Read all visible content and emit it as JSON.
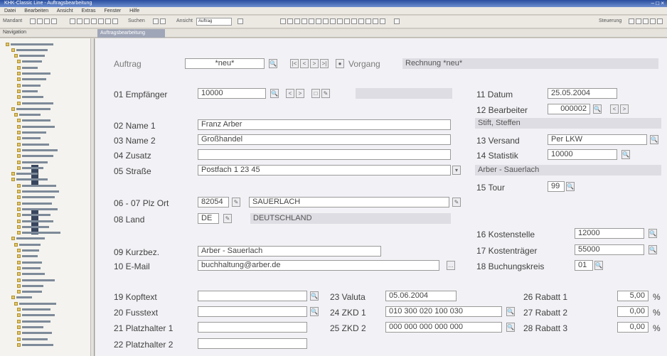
{
  "window": {
    "title": "KHK-Classic Line - Auftragsbearbeitung"
  },
  "menu": [
    "Datei",
    "Bearbeiten",
    "Ansicht",
    "Extras",
    "Fenster",
    "Hilfe"
  ],
  "toolbar": {
    "left_label": "Mandant",
    "search_placeholder": "Suchen",
    "field_label": "Ansicht",
    "combo_value": "Auftrag",
    "right_label": "Steuerung"
  },
  "tab": {
    "sidebar_title": "Navigation",
    "active": "Auftragsbearbeitung"
  },
  "header": {
    "auftrag_label": "Auftrag",
    "auftrag_value": "*neu*",
    "vorgang_label": "Vorgang",
    "vorgang_value": "Rechnung *neu*"
  },
  "fields": {
    "empfaenger": {
      "label": "01 Empfänger",
      "value": "10000"
    },
    "name1": {
      "label": "02 Name 1",
      "value": "Franz Arber"
    },
    "name2": {
      "label": "03 Name 2",
      "value": "Großhandel"
    },
    "zusatz": {
      "label": "04 Zusatz",
      "value": ""
    },
    "strasse": {
      "label": "05 Straße",
      "value": "Postfach 1 23 45"
    },
    "plz_ort": {
      "label": "06 - 07 Plz Ort",
      "plz": "82054",
      "ort": "SAUERLACH"
    },
    "land": {
      "label": "08 Land",
      "code": "DE",
      "name": "DEUTSCHLAND"
    },
    "kurzbez": {
      "label": "09 Kurzbez.",
      "value": "Arber - Sauerlach"
    },
    "email": {
      "label": "10 E-Mail",
      "value": "buchhaltung@arber.de"
    },
    "datum": {
      "label": "11 Datum",
      "value": "25.05.2004"
    },
    "bearbeiter": {
      "label": "12 Bearbeiter",
      "value": "000002",
      "name": "Stift, Steffen"
    },
    "versand": {
      "label": "13 Versand",
      "value": "Per LKW"
    },
    "statistik": {
      "label": "14 Statistik",
      "value": "10000",
      "name": "Arber - Sauerlach"
    },
    "tour": {
      "label": "15 Tour",
      "value": "99"
    },
    "kostenstelle": {
      "label": "16 Kostenstelle",
      "value": "12000"
    },
    "kostentraeger": {
      "label": "17 Kostenträger",
      "value": "55000"
    },
    "buchungskreis": {
      "label": "18 Buchungskreis",
      "value": "01"
    },
    "kopftext": {
      "label": "19 Kopftext",
      "value": ""
    },
    "fusstext": {
      "label": "20 Fusstext",
      "value": ""
    },
    "platzhalter1": {
      "label": "21 Platzhalter 1",
      "value": ""
    },
    "platzhalter2": {
      "label": "22 Platzhalter 2",
      "value": ""
    },
    "valuta": {
      "label": "23 Valuta",
      "value": "05.06.2004"
    },
    "zkd1": {
      "label": "24 ZKD 1",
      "value": "010 300 020 100 030"
    },
    "zkd2": {
      "label": "25 ZKD 2",
      "value": "000 000 000 000 000"
    },
    "rabatt1": {
      "label": "26 Rabatt 1",
      "value": "5,00",
      "unit": "%"
    },
    "rabatt2": {
      "label": "27 Rabatt 2",
      "value": "0,00",
      "unit": "%"
    },
    "rabatt3": {
      "label": "28 Rabatt 3",
      "value": "0,00",
      "unit": "%"
    }
  }
}
